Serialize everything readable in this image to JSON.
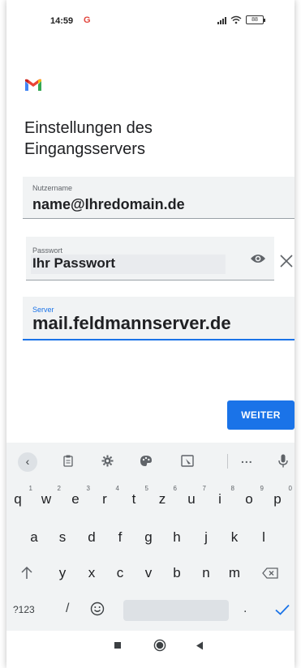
{
  "status_bar": {
    "time": "14:59",
    "google_badge": "G",
    "battery": "88",
    "icons": [
      "signal-icon",
      "wifi-icon",
      "battery-icon"
    ]
  },
  "page": {
    "title_line1": "Einstellungen des",
    "title_line2": "Eingangsservers"
  },
  "fields": {
    "username": {
      "label": "Nutzername",
      "value": "name@Ihredomain.de"
    },
    "password": {
      "label": "Passwort",
      "value": "Ihr Passwort"
    },
    "server": {
      "label": "Server",
      "value": "mail.feldmannserver.de"
    }
  },
  "buttons": {
    "next": "WEITER"
  },
  "keyboard": {
    "row1": [
      {
        "k": "q",
        "n": "1"
      },
      {
        "k": "w",
        "n": "2"
      },
      {
        "k": "e",
        "n": "3"
      },
      {
        "k": "r",
        "n": "4"
      },
      {
        "k": "t",
        "n": "5"
      },
      {
        "k": "z",
        "n": "6"
      },
      {
        "k": "u",
        "n": "7"
      },
      {
        "k": "i",
        "n": "8"
      },
      {
        "k": "o",
        "n": "9"
      },
      {
        "k": "p",
        "n": "0"
      }
    ],
    "row2": [
      "a",
      "s",
      "d",
      "f",
      "g",
      "h",
      "j",
      "k",
      "l"
    ],
    "row3": [
      "y",
      "x",
      "c",
      "v",
      "b",
      "n",
      "m"
    ],
    "symbols_key": "?123",
    "slash_key": "/",
    "period_key": ".",
    "toolbar_more": "..."
  },
  "colors": {
    "accent": "#1a73e8",
    "field_bg": "#f1f3f4",
    "keyboard_bg": "#f1f3f4"
  }
}
